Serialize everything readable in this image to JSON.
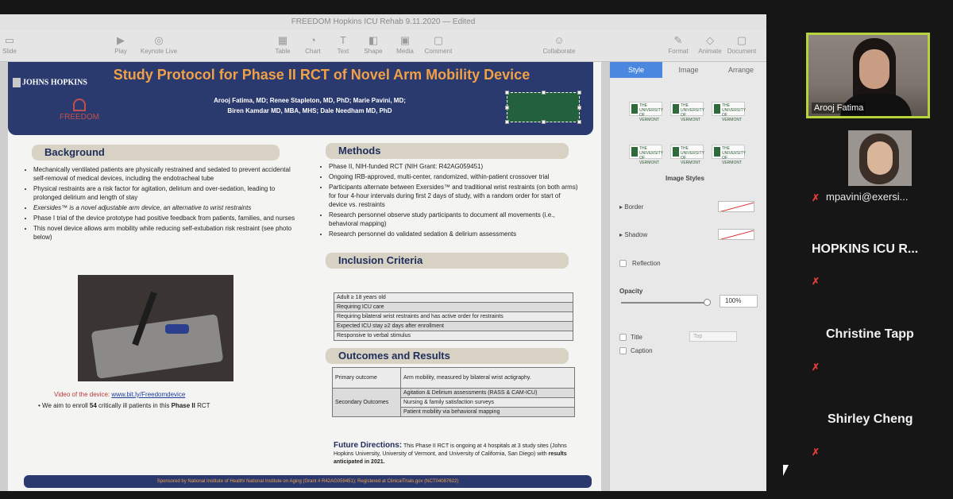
{
  "window": {
    "title": "FREEDOM Hopkins ICU Rehab 9.11.2020 — Edited"
  },
  "toolbar": {
    "items": [
      {
        "label": "Slide",
        "icon": "slide-icon"
      },
      {
        "label": "Play",
        "icon": "play-icon"
      },
      {
        "label": "Keynote Live",
        "icon": "keynote-live-icon"
      },
      {
        "label": "Table",
        "icon": "table-icon"
      },
      {
        "label": "Chart",
        "icon": "chart-icon"
      },
      {
        "label": "Text",
        "icon": "text-icon"
      },
      {
        "label": "Shape",
        "icon": "shape-icon"
      },
      {
        "label": "Media",
        "icon": "media-icon"
      },
      {
        "label": "Comment",
        "icon": "comment-icon"
      },
      {
        "label": "Collaborate",
        "icon": "collaborate-icon"
      },
      {
        "label": "Format",
        "icon": "format-icon"
      },
      {
        "label": "Animate",
        "icon": "animate-icon"
      },
      {
        "label": "Document",
        "icon": "document-icon"
      }
    ]
  },
  "poster": {
    "title": "Study Protocol for Phase II RCT of Novel Arm Mobility Device",
    "authors_line1": "Arooj Fatima, MD; Renee Stapleton, MD, PhD; Marie Pavini, MD;",
    "authors_line2": "Biren Kamdar MD, MBA, MHS; Dale Needham MD, PhD",
    "jh_logo": "JOHNS HOPKINS",
    "freedom_logo": "FREEDOM",
    "background": {
      "heading": "Background",
      "bullets": [
        "Mechanically ventilated patients are physically restrained and sedated to prevent accidental self-removal of medical devices, including the endotracheal tube",
        "Physical restraints are a risk factor for agitation, delirium and over-sedation, leading to prolonged delirium and length of stay",
        "Exersides™ is a novel adjustable arm device, an alternative to wrist restraints",
        "Phase I trial of the device prototype had positive feedback from patients, families, and nurses",
        "This novel device allows arm mobility while reducing self-extubation risk restraint (see photo below)"
      ],
      "video_prefix": "Video of the device: ",
      "video_link": "www.bit.ly/Freedomdevice",
      "enroll_pre": "We aim to enroll ",
      "enroll_num": "54",
      "enroll_mid": " critically ill patients in this ",
      "enroll_phase": "Phase II",
      "enroll_post": " RCT"
    },
    "methods": {
      "heading": "Methods",
      "bullets": [
        "Phase II, NIH-funded RCT (NIH Grant: R42AG059451)",
        "Ongoing IRB-approved, multi-center, randomized, within-patient crossover trial",
        "Participants alternate between Exersides™ and traditional wrist restraints (on both arms) for four 4-hour intervals during first 2 days of study, with a random order for start of device vs. restraints",
        "Research personnel observe study participants to document all movements (i.e., behavioral mapping)",
        "Research personnel do validated sedation & delirium assessments"
      ]
    },
    "inclusion": {
      "heading": "Inclusion Criteria",
      "rows": [
        "Adult ≥ 18 years old",
        "Requiring ICU care",
        "Requiring bilateral wrist restraints and has active order for restraints",
        "Expected ICU stay ≥2 days after enrollment",
        "Responsive to verbal stimulus"
      ]
    },
    "outcomes": {
      "heading": "Outcomes and Results",
      "primary_label": "Primary outcome",
      "primary_value": "Arm mobility, measured by bilateral wrist actigraphy.",
      "secondary_label": "Secondary Outcomes",
      "secondary_values": [
        "Agitation & Delirium assessments (RASS & CAM-ICU)",
        "Nursing & family satisfaction surveys",
        "Patient mobility via behavioral mapping"
      ]
    },
    "future": {
      "heading": "Future Directions:",
      "text": " This Phase II RCT is ongoing at 4 hospitals at 3 study sites (Johns Hopkins University, University of Vermont, and University of California, San Diego) with ",
      "bold": "results anticipated in 2021."
    },
    "footer": "Sponsored by National Institute of Health/ National Institute on Aging (Grant # R42AG059451);        Registered at ClinicalTrials.gov (NCT04087622)"
  },
  "inspector": {
    "tabs": [
      "Style",
      "Image",
      "Arrange"
    ],
    "active_tab": "Style",
    "thumb_text": "THE UNIVERSITY OF VERMONT",
    "image_styles_label": "Image Styles",
    "border_label": "Border",
    "shadow_label": "Shadow",
    "reflection_label": "Reflection",
    "opacity_label": "Opacity",
    "opacity_value": "100%",
    "opacity_level": 1.0,
    "title_label": "Title",
    "title_position": "Top",
    "caption_label": "Caption"
  },
  "participants": {
    "main_name": "Arooj Fatima",
    "second_name": "mpavini@exersi...",
    "list": [
      "HOPKINS ICU R...",
      "Christine Tapp",
      "Shirley Cheng"
    ]
  },
  "colors": {
    "poster_navy": "#2b3a6e",
    "title_orange": "#f0a046",
    "active_speaker": "#b7d33c",
    "mute_red": "#e43b3b",
    "inspector_tab": "#4a88e0"
  }
}
